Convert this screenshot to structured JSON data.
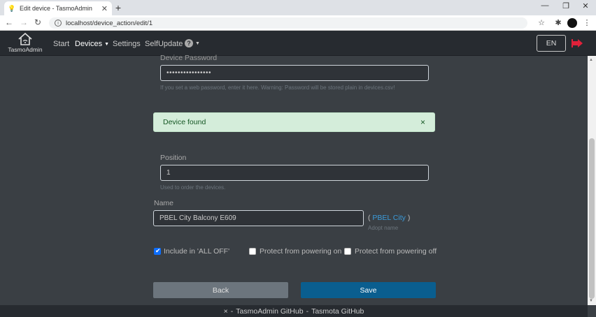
{
  "browser": {
    "tab_title": "Edit device - TasmoAdmin",
    "url": "localhost/device_action/edit/1"
  },
  "navbar": {
    "brand": "TasmoAdmin",
    "links": [
      "Start",
      "Devices",
      "Settings",
      "SelfUpdate"
    ],
    "help": "?",
    "language": "EN"
  },
  "form": {
    "password_label": "Device Password",
    "password_value": "••••••••••••••••",
    "password_help": "If you set a web password, enter it here. Warning: Password will be stored plain in devices.csv!",
    "alert_text": "Device found",
    "alert_close": "×",
    "position_label": "Position",
    "position_value": "1",
    "position_help": "Used to order the devices.",
    "name_label": "Name",
    "name_value": "PBEL City Balcony E609",
    "name_suggestion": "PBEL City",
    "name_paren_open": "(",
    "name_paren_close": ")",
    "name_suggestion_help": "Adopt name",
    "checkboxes": [
      {
        "label": "Include in 'ALL OFF'",
        "checked": true
      },
      {
        "label": "Protect from powering on",
        "checked": false
      },
      {
        "label": "Protect from powering off",
        "checked": false
      }
    ],
    "back_label": "Back",
    "save_label": "Save"
  },
  "footer": {
    "close": "×",
    "sep1": "-",
    "tasmoadmin_link": "TasmoAdmin GitHub",
    "sep2": "-",
    "tasmota_link": "Tasmota GitHub"
  }
}
